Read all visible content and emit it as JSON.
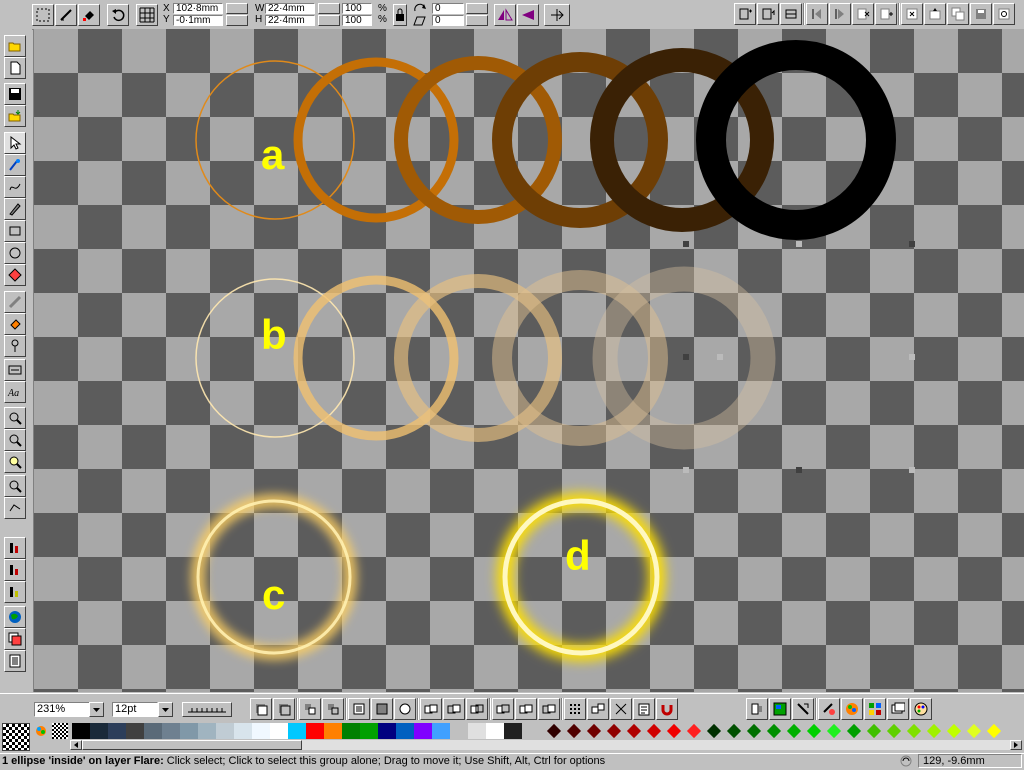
{
  "top_toolbar": {
    "x_value": "102·8mm",
    "y_value": "-0·1mm",
    "w_value": "22·4mm",
    "h_value": "22·4mm",
    "scale_x": "100",
    "scale_y": "100",
    "angle_value": "0",
    "skew_value": "0",
    "x_label": "X",
    "y_label": "Y",
    "w_label": "W",
    "h_label": "H",
    "percent_label": "%"
  },
  "canvas": {
    "labels": [
      "a",
      "b",
      "c",
      "d"
    ],
    "label_color": "#ffff00",
    "row_a_colors": [
      "#e08a1a",
      "#c46f06",
      "#a05a05",
      "#6e3e05",
      "#3a2105",
      "#000000"
    ]
  },
  "bottom_toolbar": {
    "zoom_value": "231%",
    "font_size_value": "12pt"
  },
  "status": {
    "message_bold": "1 ellipse 'inside' on layer Flare:",
    "message_rest": " Click select; Click to select this group alone; Drag to move it; Use Shift, Alt, Ctrl for options",
    "coords": "129, -9.6mm"
  },
  "palette": {
    "colors": [
      "#000000",
      "#1a2a3a",
      "#2c3e5a",
      "#404040",
      "#5a6a78",
      "#6e8090",
      "#8098a8",
      "#a0b4c0",
      "#c0ccd4",
      "#d8e4ec",
      "#f0f8ff",
      "#ffffff",
      "#00c8ff",
      "#ff0000",
      "#ff8000",
      "#008000",
      "#00a000",
      "#000080",
      "#0060c0",
      "#8000ff",
      "#40a0ff",
      "#c0c0c0",
      "#e0e0e0",
      "#ffffff",
      "#202020"
    ],
    "diamonds": [
      "#300000",
      "#500000",
      "#700000",
      "#900000",
      "#b00000",
      "#d00000",
      "#f00000",
      "#ff2020",
      "#003000",
      "#005000",
      "#007000",
      "#009000",
      "#00b000",
      "#00d000",
      "#20f020",
      "#00a000",
      "#40c000",
      "#60d000",
      "#80e000",
      "#a0f000",
      "#c0ff00",
      "#e0ff20",
      "#ffff00"
    ]
  }
}
